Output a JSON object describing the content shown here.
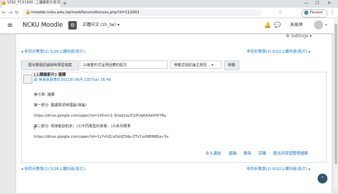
{
  "browser": {
    "tab_title": "1092_F131900 :上課錄影片方法",
    "tab_close": "×",
    "newtab": "+",
    "minimize": "—",
    "maximize": "☐",
    "close": "✕",
    "back": "←",
    "forward": "→",
    "reload": "↻",
    "lock": "🔒",
    "url": "moodle.ncku.edu.tw/mod/forum/discuss.php?d=112001",
    "star": "☆",
    "profile_label": "Paused",
    "menu": "⋮"
  },
  "moodle": {
    "hamburger": "≡",
    "brand": "NCKU Moodle",
    "brand_icon": "⚙",
    "language": "正體中文 (zh_tw) ▾",
    "bell": "🔔",
    "chat": "💬",
    "user_name": "吳易承",
    "user_caret": "▾"
  },
  "discussion": {
    "settings_label": "⚙ Settings ▾",
    "prev_top": "◂ 非同步教學(2) 5/26上課內容(影片)",
    "next_top": "非同步教學(2) 6/02上課內容(影片) ▸",
    "export_button": "匯出整個討論版到學習檔案",
    "sort_select": "以嵌套形式呈現回應的貼文",
    "move_select": "移動這個討論主題至... ▾",
    "move_button": "移動",
    "prev_bottom": "◂ 非同步教學(2) 5/26上課內容(影片)",
    "next_bottom": "非同步教學(2) 6/02上課內容(影片) ▸"
  },
  "post": {
    "subject": "[上課錄影片] 連課",
    "byline": "由 吳易承發表於2021年 06月 1日(Tue) 16:49",
    "lines": [
      "第七章: 連課",
      "第一部分: 醫護與領導理論(導論)",
      "https://drive.google.com/open?id=1Vhmn1-3Uod1ouTj1PUqKAXeXHrYRu",
      "第二部分: 領導能訓初步；(1)不同風型的考量、(2)系列標準",
      "https://drive.google.com/open?id=1cYvhZcsOshZ0dp-ZTz7vsNB9N8un-5v"
    ],
    "actions": [
      "永久連結",
      "編輯",
      "刪除",
      "回覆",
      "匯出到學習歷程檔案"
    ]
  },
  "ui": {
    "to_top": "⌃",
    "cursor": "I"
  }
}
